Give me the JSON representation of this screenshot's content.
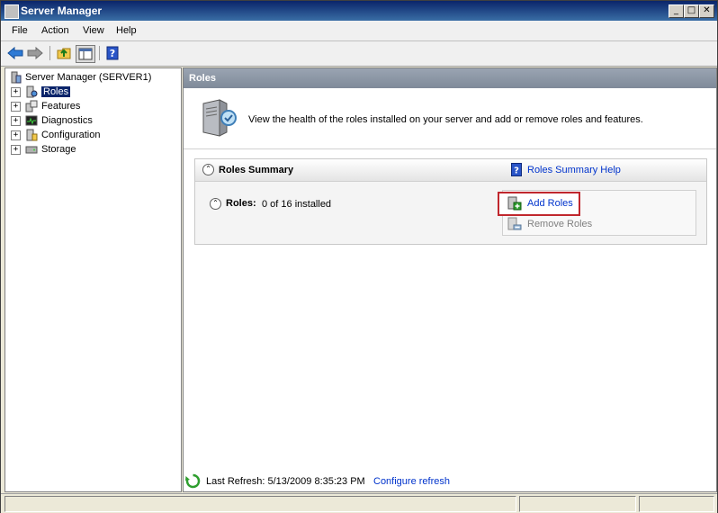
{
  "window": {
    "title": "Server Manager"
  },
  "menu": [
    "File",
    "Action",
    "View",
    "Help"
  ],
  "toolbar": {
    "buttons": [
      "back-icon",
      "forward-icon",
      "up-folder-icon",
      "show-hide-tree-icon",
      "help-icon"
    ]
  },
  "tree": {
    "root": "Server Manager (SERVER1)",
    "items": [
      {
        "label": "Roles",
        "selected": true
      },
      {
        "label": "Features"
      },
      {
        "label": "Diagnostics"
      },
      {
        "label": "Configuration"
      },
      {
        "label": "Storage"
      }
    ]
  },
  "content": {
    "header": "Roles",
    "description": "View the health of the roles installed on your server and add or remove roles and features.",
    "summary": {
      "title": "Roles Summary",
      "help_link": "Roles Summary Help",
      "roles_label": "Roles:",
      "roles_status": "0 of 16 installed",
      "add_roles": "Add Roles",
      "remove_roles": "Remove Roles"
    },
    "refresh": {
      "label": "Last Refresh: 5/13/2009 8:35:23 PM",
      "configure": "Configure refresh"
    }
  },
  "colors": {
    "title_bar": "#0a246a",
    "link": "#0033cc",
    "highlight_border": "#c0272d"
  }
}
